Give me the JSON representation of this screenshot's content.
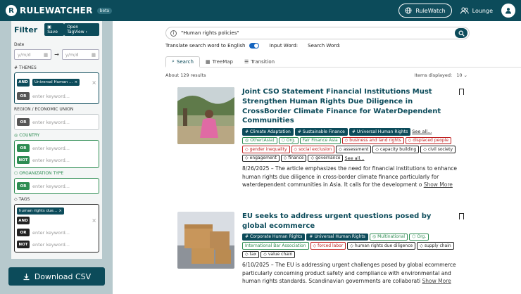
{
  "app": {
    "name": "RULEWATCHER",
    "badge": "beta",
    "nav_primary": "RuleWatch",
    "nav_secondary": "Lounge"
  },
  "filter": {
    "title": "Filter",
    "save": "Save",
    "tagview": "Open TagView",
    "date_label": "Date",
    "date_from": "y/m/d",
    "date_to": "y/m/d",
    "themes": {
      "label": "THEMES",
      "chip": "Universal Human …",
      "op1": "AND",
      "op2": "OR",
      "ph": "enter keyword..."
    },
    "region": {
      "label": "REGION / ECONOMIC UNION",
      "op": "OR",
      "ph": "enter keyword..."
    },
    "country": {
      "label": "COUNTRY",
      "op1": "OR",
      "op2": "NOT",
      "ph": "enter keyword..."
    },
    "orgtype": {
      "label": "ORGANIZATION TYPE",
      "op": "OR",
      "ph": "enter keyword..."
    },
    "tags": {
      "label": "TAGS",
      "chip": "human rights due…",
      "op1": "AND",
      "op2": "OR",
      "op3": "NOT",
      "ph": "enter keyword..."
    }
  },
  "download": "Download CSV",
  "search": {
    "value": "\"Human rights policies\""
  },
  "translate": {
    "label": "Translate search word to English",
    "input_word": "Input Word:",
    "search_word": "Search Word:"
  },
  "tabs": [
    "Search",
    "TreeMap",
    "Transition"
  ],
  "results": {
    "count": "About 129 results",
    "display_label": "Items displayed:",
    "display_value": "10"
  },
  "articles": [
    {
      "title": "Joint CSO Statement Financial Institutions Must Strengthen Human Rights Due Diligence in CrossBorder Climate Finance for WaterDependent Communities",
      "tags": [
        {
          "t": "Climate Adaptation",
          "k": "dk",
          "i": "#"
        },
        {
          "t": "Sustainable Finance",
          "k": "dk",
          "i": "#"
        },
        {
          "t": "Universal Human Rights",
          "k": "dk",
          "i": "#"
        },
        {
          "t": "See all...",
          "k": "see"
        },
        {
          "t": "Other(Asia)",
          "k": "gr",
          "i": "◎"
        },
        {
          "t": "Org.",
          "k": "gr",
          "i": "⬡"
        },
        {
          "t": "Fair Finance Asia",
          "k": "gr",
          "i": ""
        },
        {
          "t": "business and land rights",
          "k": "rd",
          "i": "◇"
        },
        {
          "t": "displaced people",
          "k": "rd",
          "i": "◇"
        },
        {
          "t": "gender inequality",
          "k": "rd",
          "i": "◇"
        },
        {
          "t": "social exclusion",
          "k": "rd",
          "i": "◇"
        },
        {
          "t": "assessment",
          "k": "bk",
          "i": "◇"
        },
        {
          "t": "capacity building",
          "k": "bk",
          "i": "◇"
        },
        {
          "t": "civil society",
          "k": "bk",
          "i": "◇"
        },
        {
          "t": "engagement",
          "k": "bk",
          "i": "◇"
        },
        {
          "t": "finance",
          "k": "bk",
          "i": "◇"
        },
        {
          "t": "governance",
          "k": "bk",
          "i": "◇"
        },
        {
          "t": "See all...",
          "k": "see"
        }
      ],
      "desc": "8/26/2025 – The article emphasizes the need for financial institutions to enhance human rights due diligence in cross-border climate finance particularly for waterdependent communities in Asia. It calls for the development o",
      "more": "Show More"
    },
    {
      "title": "EU seeks to address urgent questions posed by global ecommerce",
      "tags": [
        {
          "t": "Corporate Human Rights",
          "k": "dk",
          "i": "#"
        },
        {
          "t": "Universal Human Rights",
          "k": "dk",
          "i": "#"
        },
        {
          "t": "Multinational",
          "k": "gr",
          "i": "◎"
        },
        {
          "t": "Org.",
          "k": "gr",
          "i": "⬡"
        },
        {
          "t": "International Bar Association",
          "k": "gr",
          "i": ""
        },
        {
          "t": "forced labor",
          "k": "rd",
          "i": "◇"
        },
        {
          "t": "human rights due diligence",
          "k": "bk",
          "i": "◇"
        },
        {
          "t": "supply chain",
          "k": "bk",
          "i": "◇"
        },
        {
          "t": "tax",
          "k": "bk",
          "i": "◇"
        },
        {
          "t": "value chain",
          "k": "bk",
          "i": "◇"
        }
      ],
      "desc": "6/10/2025 – The EU is addressing urgent challenges posed by global ecommerce particularly concerning product safety and compliance with environmental and human rights standards. Scandinavian governments are collaborati",
      "more": "Show More"
    }
  ],
  "colors": {
    "brand": "#0c4b5a",
    "green": "#2d8c52",
    "red": "#c02020"
  }
}
